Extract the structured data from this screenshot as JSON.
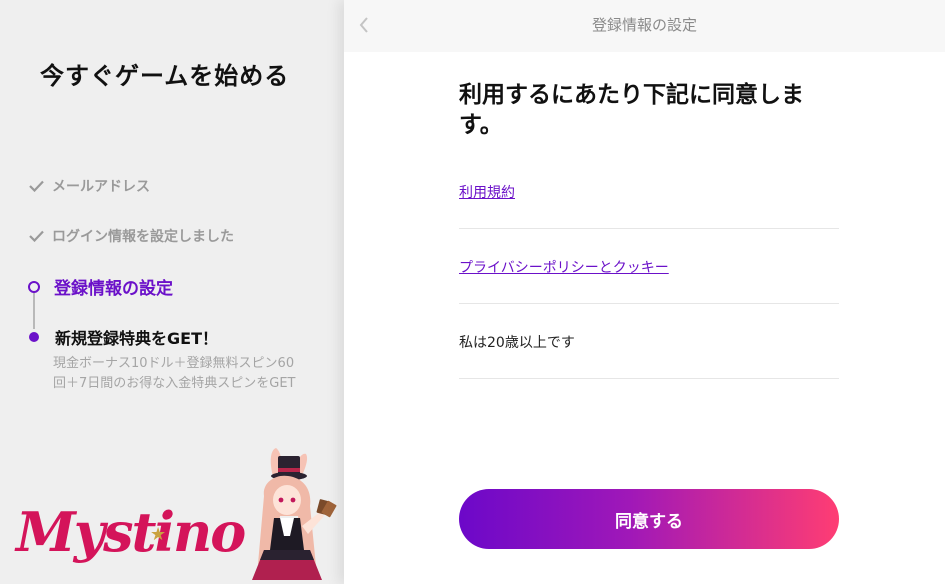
{
  "left": {
    "title": "今すぐゲームを始める",
    "steps": [
      {
        "label": "メールアドレス",
        "state": "done"
      },
      {
        "label": "ログイン情報を設定しました",
        "state": "done"
      },
      {
        "label": "登録情報の設定",
        "state": "active"
      },
      {
        "label": "新規登録特典をGET！",
        "state": "next",
        "description": "現金ボーナス10ドル＋登録無料スピン60回＋7日間のお得な入金特典スピンをGET"
      }
    ],
    "logo_text": "Mystino"
  },
  "header": {
    "title": "登録情報の設定",
    "back_icon": "chevron-left-icon"
  },
  "main": {
    "heading": "利用するにあたり下記に同意します。",
    "items": [
      {
        "label": "利用規約",
        "type": "link"
      },
      {
        "label": "プライバシーポリシーとクッキー",
        "type": "link"
      },
      {
        "label": "私は20歳以上です",
        "type": "text"
      }
    ],
    "agree_button": "同意する"
  },
  "colors": {
    "accent": "#6b11c9",
    "button_gradient_start": "#6c08c9",
    "button_gradient_end": "#ff3d73",
    "logo": "#d4145a"
  }
}
